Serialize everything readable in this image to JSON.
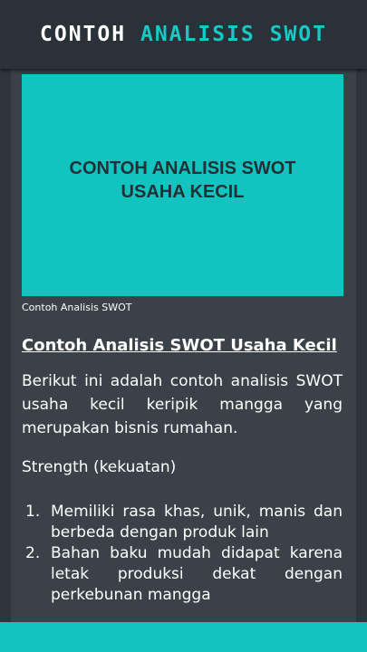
{
  "app": {
    "title_part1": "CONTOH",
    "title_part2": "ANALISIS SWOT"
  },
  "article": {
    "hero_text": "CONTOH ANALISIS SWOT\nUSAHA KECIL",
    "caption": "Contoh Analisis SWOT",
    "heading": "Contoh Analisis SWOT Usaha Kecil",
    "intro": "Berikut ini adalah contoh analisis SWOT usaha kecil keripik mangga yang merupakan bisnis rumahan.",
    "strength_title": "Strength (kekuatan)",
    "strengths": [
      {
        "num": "1.",
        "text": "Memiliki rasa khas, unik, manis dan berbeda dengan produk lain"
      },
      {
        "num": "2.",
        "text": "Bahan baku mudah didapat karena letak produksi dekat dengan perkebunan mangga"
      }
    ]
  },
  "colors": {
    "accent": "#14c3bf",
    "appbar": "#2b3138",
    "content_bg": "#3b4148"
  }
}
